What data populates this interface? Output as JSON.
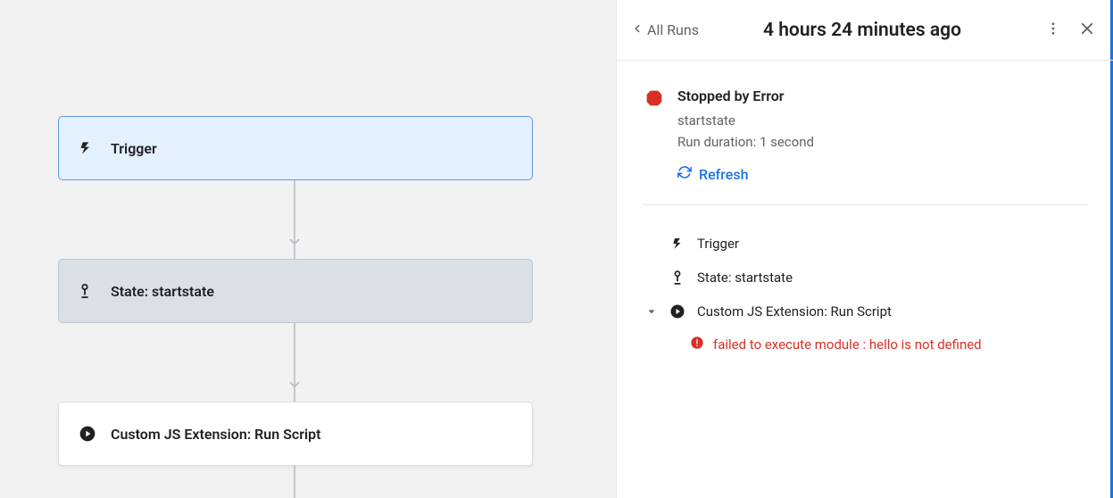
{
  "canvas": {
    "trigger_label": "Trigger",
    "state_label": "State: startstate",
    "action_label": "Custom JS Extension: Run Script"
  },
  "panel": {
    "back_label": "All Runs",
    "title": "4 hours 24 minutes ago",
    "status": {
      "title": "Stopped by Error",
      "state_name": "startstate",
      "duration_label": "Run duration: 1 second",
      "refresh_label": "Refresh"
    },
    "steps": {
      "trigger": "Trigger",
      "state": "State: startstate",
      "action": "Custom JS Extension: Run Script",
      "error_message": "failed to execute module : hello is not defined"
    }
  },
  "colors": {
    "error_red": "#d93025",
    "link_blue": "#1a73e8"
  }
}
